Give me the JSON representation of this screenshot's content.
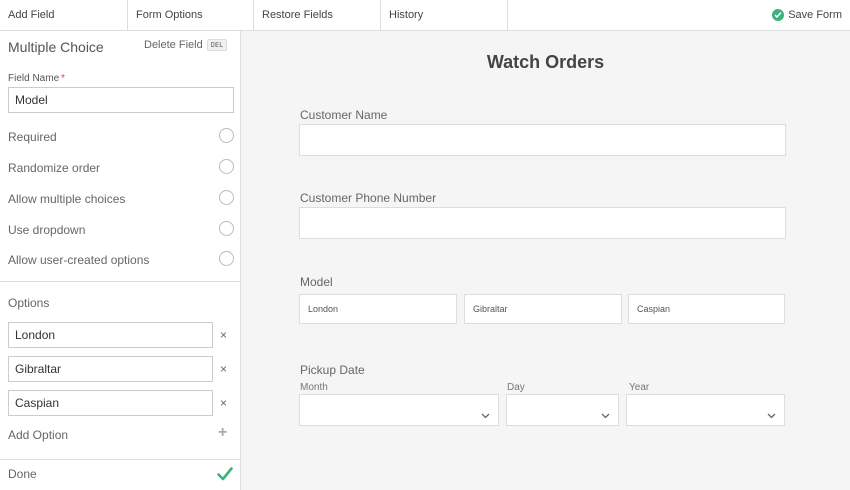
{
  "toolbar": {
    "add_field": "Add Field",
    "form_options": "Form Options",
    "restore_fields": "Restore Fields",
    "history": "History",
    "save_form": "Save Form"
  },
  "sidebar": {
    "title": "Multiple Choice",
    "delete_field": "Delete Field",
    "delete_shortcut": "DEL",
    "field_name_label": "Field Name",
    "required_marker": "*",
    "field_name_value": "Model",
    "toggles": [
      {
        "label": "Required"
      },
      {
        "label": "Randomize order"
      },
      {
        "label": "Allow multiple choices"
      },
      {
        "label": "Use dropdown"
      },
      {
        "label": "Allow user-created options"
      }
    ],
    "options_label": "Options",
    "choices": [
      "London",
      "Gibraltar",
      "Caspian"
    ],
    "remove_glyph": "×",
    "add_option": "Add Option",
    "add_glyph": "+",
    "done": "Done"
  },
  "form": {
    "title": "Watch Orders",
    "customer_name_label": "Customer Name",
    "customer_phone_label": "Customer Phone Number",
    "model_label": "Model",
    "model_choices": [
      "London",
      "Gibraltar",
      "Caspian"
    ],
    "pickup_label": "Pickup Date",
    "month_label": "Month",
    "day_label": "Day",
    "year_label": "Year"
  },
  "colors": {
    "accent_green": "#3bb37a",
    "required_red": "#e35",
    "preview_bg": "#f5f5f5"
  },
  "icons": {
    "save": "check-circle-icon",
    "done": "checkmark-icon",
    "select": "chevron-down-icon"
  }
}
